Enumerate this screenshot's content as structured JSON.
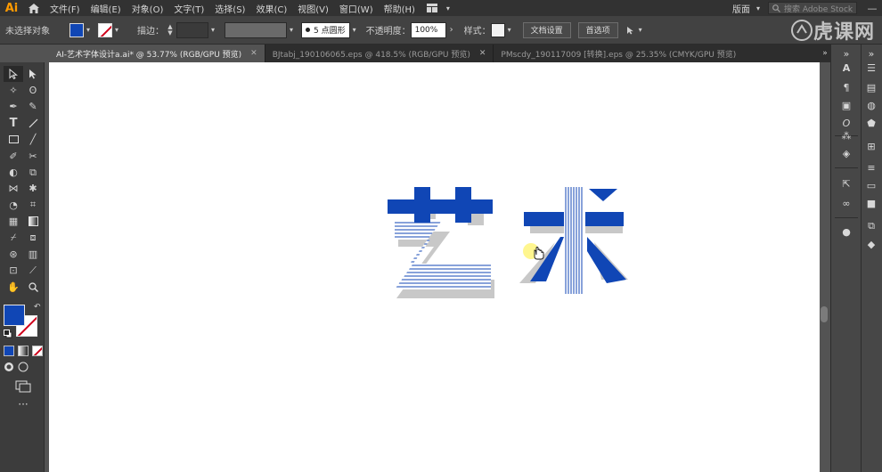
{
  "app": {
    "logo": "Ai"
  },
  "menu": {
    "items": [
      "文件(F)",
      "编辑(E)",
      "对象(O)",
      "文字(T)",
      "选择(S)",
      "效果(C)",
      "视图(V)",
      "窗口(W)",
      "帮助(H)"
    ],
    "workspace": "版面",
    "search_placeholder": "搜索 Adobe Stock"
  },
  "control": {
    "selection_status": "未选择对象",
    "stroke_label": "描边：",
    "brush": "5 点圆形",
    "opacity_label": "不透明度：",
    "opacity_value": "100%",
    "style_label": "样式：",
    "doc_setup": "文档设置",
    "preferences": "首选项",
    "watermark": "虎课网"
  },
  "tabs": [
    {
      "label": "AI-艺术字体设计a.ai* @ 53.77% (RGB/GPU 预览)",
      "active": true
    },
    {
      "label": "BJtabj_190106065.eps @ 418.5% (RGB/GPU 预览)",
      "active": false
    },
    {
      "label": "PMscdy_190117009 [转换].eps @ 25.35% (CMYK/GPU 预览)",
      "active": false
    }
  ],
  "colors": {
    "accent": "#1046b5",
    "shadow": "#c8c8c8",
    "app_bg": "#535353"
  },
  "artwork": {
    "text": "艺术",
    "fill": "#1046b5",
    "stripe": "#1046b5"
  }
}
